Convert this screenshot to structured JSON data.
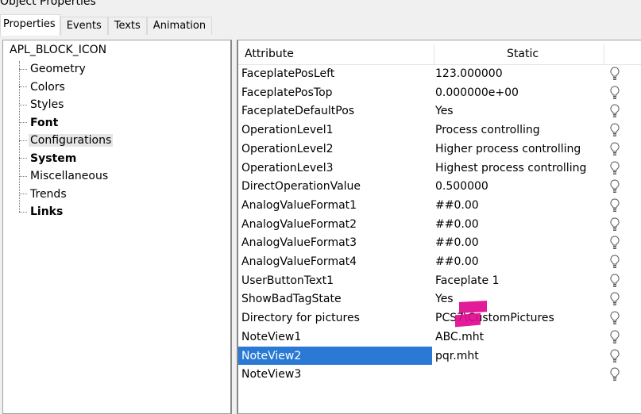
{
  "window": {
    "title": "Object Properties"
  },
  "tabs": [
    {
      "label": "Properties"
    },
    {
      "label": "Events"
    },
    {
      "label": "Texts"
    },
    {
      "label": "Animation"
    }
  ],
  "tree": {
    "root": "APL_BLOCK_ICON",
    "items": [
      {
        "label": "Geometry",
        "bold": false,
        "selected": false
      },
      {
        "label": "Colors",
        "bold": false,
        "selected": false
      },
      {
        "label": "Styles",
        "bold": false,
        "selected": false
      },
      {
        "label": "Font",
        "bold": true,
        "selected": false
      },
      {
        "label": "Configurations",
        "bold": false,
        "selected": true
      },
      {
        "label": "System",
        "bold": true,
        "selected": false
      },
      {
        "label": "Miscellaneous",
        "bold": false,
        "selected": false
      },
      {
        "label": "Trends",
        "bold": false,
        "selected": false
      },
      {
        "label": "Links",
        "bold": true,
        "selected": false
      }
    ]
  },
  "table": {
    "headers": {
      "attribute": "Attribute",
      "static": "Static"
    },
    "rows": [
      {
        "attribute": "FaceplatePosLeft",
        "value": "123.000000"
      },
      {
        "attribute": "FaceplatePosTop",
        "value": "0.000000e+00"
      },
      {
        "attribute": "FaceplateDefaultPos",
        "value": "Yes"
      },
      {
        "attribute": "OperationLevel1",
        "value": "Process controlling"
      },
      {
        "attribute": "OperationLevel2",
        "value": "Higher process controlling"
      },
      {
        "attribute": "OperationLevel3",
        "value": "Highest process controlling"
      },
      {
        "attribute": "DirectOperationValue",
        "value": "0.500000"
      },
      {
        "attribute": "AnalogValueFormat1",
        "value": "##0.00"
      },
      {
        "attribute": "AnalogValueFormat2",
        "value": "##0.00"
      },
      {
        "attribute": "AnalogValueFormat3",
        "value": "##0.00"
      },
      {
        "attribute": "AnalogValueFormat4",
        "value": "##0.00"
      },
      {
        "attribute": "UserButtonText1",
        "value": "Faceplate 1"
      },
      {
        "attribute": "ShowBadTagState",
        "value": "Yes"
      },
      {
        "attribute": "Directory for pictures",
        "value": "PCS7\\CustomPictures"
      },
      {
        "attribute": "NoteView1",
        "value": "ABC.mht"
      },
      {
        "attribute": "NoteView2",
        "value": "pqr.mht",
        "selected": true
      },
      {
        "attribute": "NoteView3",
        "value": ""
      }
    ]
  },
  "colors": {
    "selection": "#2a7ad5",
    "annotation": "#e0088f"
  }
}
